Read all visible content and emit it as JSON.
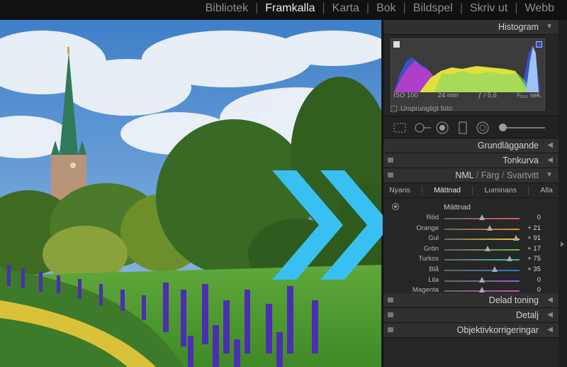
{
  "modules": [
    "Bibliotek",
    "Framkalla",
    "Karta",
    "Bok",
    "Bildspel",
    "Skriv ut",
    "Webb"
  ],
  "active_module": "Framkalla",
  "panels": {
    "histogram": "Histogram",
    "grundlaggande": "Grundläggande",
    "tonkurva": "Tonkurva",
    "hsl_title_parts": [
      "NML",
      "Färg",
      "Svartvitt"
    ],
    "delad_toning": "Delad toning",
    "detalj": "Detalj",
    "objektiv": "Objektivkorrigeringar"
  },
  "exif": {
    "iso": "ISO 100",
    "focal": "24 mm",
    "aperture": "ƒ / 5,6",
    "shutter": "¹⁄₂₅₀ sek."
  },
  "original_photo": "Ursprungligt foto",
  "hsl_tabs": [
    "Nyans",
    "Mättnad",
    "Luminans",
    "Alla"
  ],
  "active_hsl_tab": "Mättnad",
  "saturation_title": "Mättnad",
  "saturation": [
    {
      "label": "Röd",
      "value": "0",
      "pos": 0.5,
      "color": "#d65b5b"
    },
    {
      "label": "Orange",
      "value": "+ 21",
      "pos": 0.6,
      "color": "#e58a2e"
    },
    {
      "label": "Gul",
      "value": "+ 91",
      "pos": 0.95,
      "color": "#e0cf35"
    },
    {
      "label": "Grön",
      "value": "+ 17",
      "pos": 0.58,
      "color": "#5fbf49"
    },
    {
      "label": "Turkos",
      "value": "+ 75",
      "pos": 0.87,
      "color": "#39c0b0"
    },
    {
      "label": "Blå",
      "value": "+ 35",
      "pos": 0.67,
      "color": "#3f73da"
    },
    {
      "label": "Lila",
      "value": "0",
      "pos": 0.5,
      "color": "#9b5ad6"
    },
    {
      "label": "Magenta",
      "value": "0",
      "pos": 0.5,
      "color": "#d04fb9"
    }
  ],
  "colors": {
    "accent_arrow": "#39c0f2",
    "panel_bg": "#262626",
    "header_bg": "#303030"
  }
}
